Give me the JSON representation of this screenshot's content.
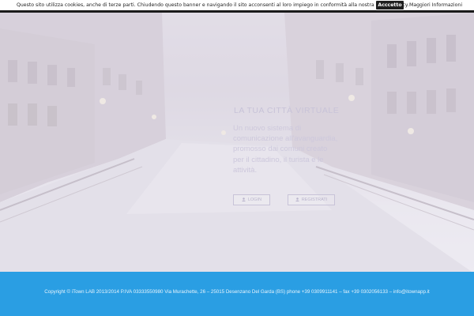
{
  "cookie_banner": {
    "text": "Questo sito utilizza cookies, anche di terze parti. Chiudendo questo banner e navigando il sito acconsenti al loro impiego in conformità alla nostra Cookie Policy.",
    "accept_label": "Acccetto",
    "more_info_label": "Maggiori Informazioni"
  },
  "hero": {
    "title": "LA TUA CITTÀ VIRTUALE",
    "description": "Un nuovo sistema di comunicazione all'avanguardia, promosso dai comuni creato per il cittadino, il turista e le attività.",
    "login_label": "LOGIN",
    "register_label": "REGISTRATI",
    "user_icon": "user-icon"
  },
  "footer": {
    "text": "Copyright © iTown LAB 2013/2014 P.IVA 03333550980 Via Murachette, 26 – 25015 Desenzano Del Garda (BS) phone +39 0309911141 – fax +39 0302056133 – info@itownapp.it"
  },
  "colors": {
    "footer_bg": "#2a9ee3",
    "accept_bg": "#1f1f1f",
    "hero_text": "#c8c3d8"
  }
}
